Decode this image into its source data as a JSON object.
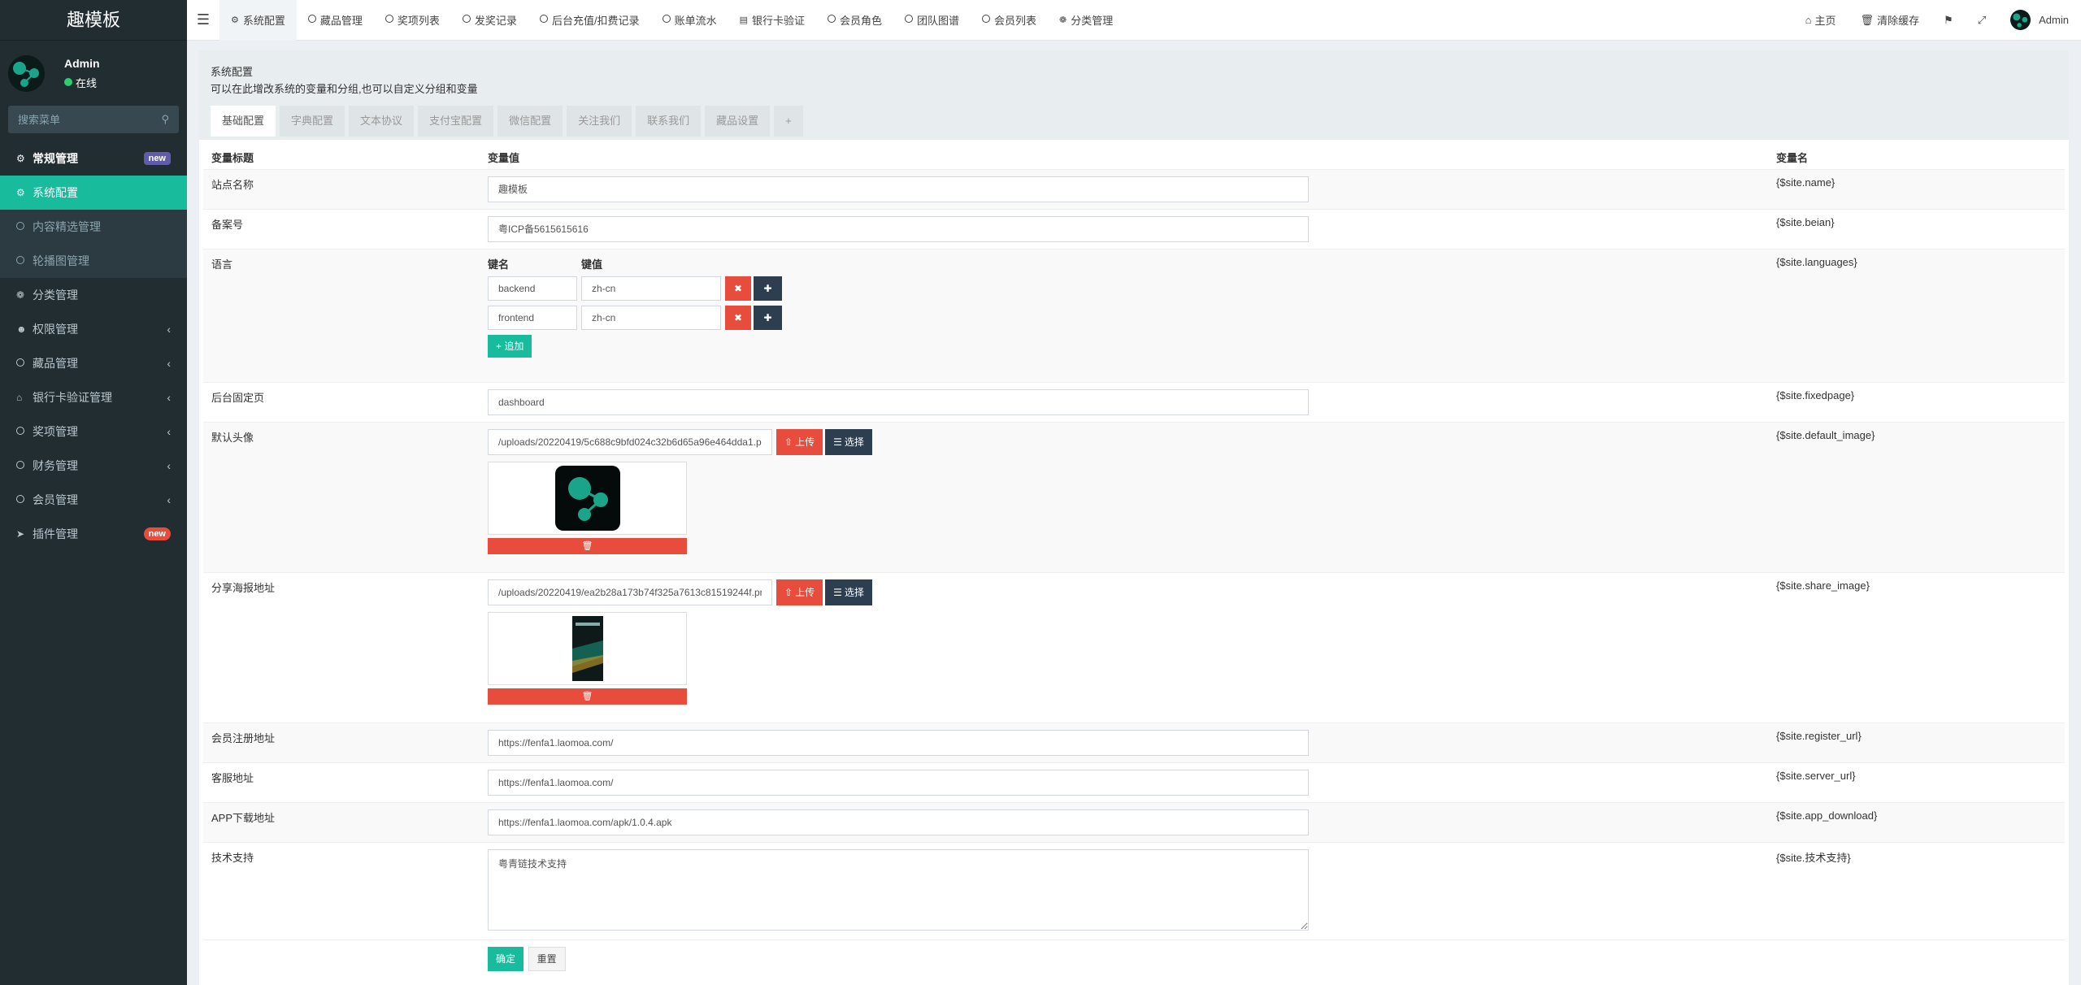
{
  "sidebar": {
    "logo": "趣模板",
    "user": {
      "name": "Admin",
      "status": "在线"
    },
    "search_placeholder": "搜索菜单",
    "items": [
      {
        "label": "常规管理",
        "badge": "new"
      },
      {
        "label": "系统配置"
      },
      {
        "label": "内容精选管理"
      },
      {
        "label": "轮播图管理"
      },
      {
        "label": "分类管理"
      },
      {
        "label": "权限管理"
      },
      {
        "label": "藏品管理"
      },
      {
        "label": "银行卡验证管理"
      },
      {
        "label": "奖项管理"
      },
      {
        "label": "财务管理"
      },
      {
        "label": "会员管理"
      },
      {
        "label": "插件管理",
        "badge": "new"
      }
    ]
  },
  "topnav": {
    "tabs": [
      "系统配置",
      "藏品管理",
      "奖项列表",
      "发奖记录",
      "后台充值/扣费记录",
      "账单流水",
      "银行卡验证",
      "会员角色",
      "团队图谱",
      "会员列表",
      "分类管理"
    ],
    "home": "主页",
    "clear_cache": "清除缓存",
    "user": "Admin"
  },
  "panel": {
    "title": "系统配置",
    "desc": "可以在此增改系统的变量和分组,也可以自定义分组和变量",
    "tabs": [
      "基础配置",
      "字典配置",
      "文本协议",
      "支付宝配置",
      "微信配置",
      "关注我们",
      "联系我们",
      "藏品设置",
      "+"
    ]
  },
  "table": {
    "headers": [
      "变量标题",
      "变量值",
      "变量名"
    ],
    "site_name": {
      "label": "站点名称",
      "value": "趣模板",
      "var": "{$site.name}"
    },
    "beian": {
      "label": "备案号",
      "value": "粤ICP备5615615616",
      "var": "{$site.beian}"
    },
    "languages": {
      "label": "语言",
      "key_header": "键名",
      "val_header": "键值",
      "rows": [
        {
          "key": "backend",
          "val": "zh-cn"
        },
        {
          "key": "frontend",
          "val": "zh-cn"
        }
      ],
      "add": "+ 追加",
      "var": "{$site.languages}"
    },
    "fixedpage": {
      "label": "后台固定页",
      "value": "dashboard",
      "var": "{$site.fixedpage}"
    },
    "default_image": {
      "label": "默认头像",
      "value": "/uploads/20220419/5c688c9bfd024c32b6d65a96e464dda1.png",
      "upload": "上传",
      "choose": "选择",
      "var": "{$site.default_image}"
    },
    "share_image": {
      "label": "分享海报地址",
      "value": "/uploads/20220419/ea2b28a173b74f325a7613c81519244f.png",
      "upload": "上传",
      "choose": "选择",
      "var": "{$site.share_image}"
    },
    "register_url": {
      "label": "会员注册地址",
      "value": "https://fenfa1.laomoa.com/",
      "var": "{$site.register_url}"
    },
    "server_url": {
      "label": "客服地址",
      "value": "https://fenfa1.laomoa.com/",
      "var": "{$site.server_url}"
    },
    "app_download": {
      "label": "APP下载地址",
      "value": "https://fenfa1.laomoa.com/apk/1.0.4.apk",
      "var": "{$site.app_download}"
    },
    "tech": {
      "label": "技术支持",
      "value": "粤青链技术支持",
      "var": "{$site.技术支持}"
    },
    "submit": "确定",
    "reset": "重置"
  },
  "colors": {
    "accent": "#18bc9c",
    "sidebar": "#222d32",
    "danger": "#e74c3c",
    "dark": "#2c3e50"
  }
}
